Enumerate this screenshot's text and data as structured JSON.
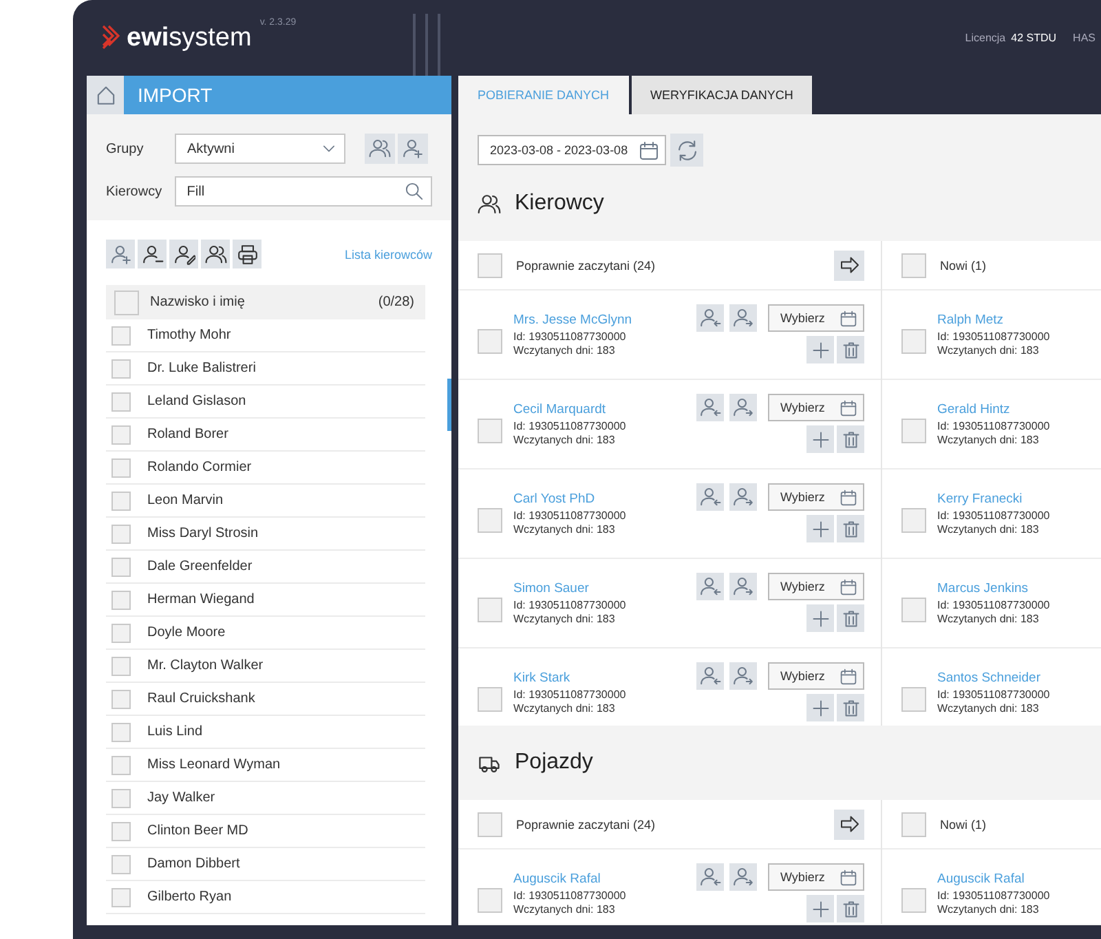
{
  "header": {
    "logo": "**ewi**system",
    "version": "v. 2.3.29",
    "license_label": "Licencja",
    "license_value": "42 STDU",
    "user": "HAS"
  },
  "sidebar": {
    "title": "IMPORT",
    "filters": [
      {
        "kind": "select",
        "label": "Grupy",
        "value": "Aktywni"
      },
      {
        "kind": "search",
        "label": "Kierowcy",
        "value": "Fill"
      }
    ],
    "link": "Lista kierowców",
    "list": {
      "header": "Nazwisko i imię",
      "count": "(0/28)",
      "checked": false,
      "items": [
        {
          "name": "Timothy Mohr",
          "checked": false
        },
        {
          "name": "Dr. Luke Balistreri",
          "checked": false
        },
        {
          "name": "Leland Gislason",
          "checked": false
        },
        {
          "name": "Roland Borer",
          "checked": false
        },
        {
          "name": "Rolando Cormier",
          "checked": false
        },
        {
          "name": "Leon Marvin",
          "checked": false
        },
        {
          "name": "Miss Daryl Strosin",
          "checked": false
        },
        {
          "name": "Dale Greenfelder",
          "checked": false
        },
        {
          "name": "Herman Wiegand",
          "checked": false
        },
        {
          "name": "Doyle Moore",
          "checked": false
        },
        {
          "name": "Mr. Clayton Walker",
          "checked": false
        },
        {
          "name": "Raul Cruickshank",
          "checked": false
        },
        {
          "name": "Luis Lind",
          "checked": false
        },
        {
          "name": "Miss Leonard Wyman",
          "checked": false
        },
        {
          "name": "Jay Walker",
          "checked": false
        },
        {
          "name": "Clinton Beer MD",
          "checked": false
        },
        {
          "name": "Damon Dibbert",
          "checked": false
        },
        {
          "name": "Gilberto Ryan",
          "checked": false
        }
      ]
    }
  },
  "main": {
    "tabs": [
      {
        "label": "POBIERANIE DANYCH",
        "selected": true
      },
      {
        "label": "WERYFIKACJA DANYCH",
        "selected": false
      }
    ],
    "date_range": "2023-03-08 - 2023-03-08",
    "sections": [
      {
        "kind": "drivers",
        "title": "Kierowcy",
        "left": {
          "header": "Poprawnie zaczytani (24)",
          "checked": false,
          "rows": [
            {
              "name": "Mrs. Jesse McGlynn",
              "id": "Id:  1930511087730000",
              "days": "Wczytanych dni:  183",
              "button": "Wybierz",
              "checked": false
            },
            {
              "name": "Cecil Marquardt",
              "id": "Id:  1930511087730000",
              "days": "Wczytanych dni:  183",
              "button": "Wybierz",
              "checked": false
            },
            {
              "name": "Carl Yost PhD",
              "id": "Id:  1930511087730000",
              "days": "Wczytanych dni:  183",
              "button": "Wybierz",
              "checked": false
            },
            {
              "name": "Simon Sauer",
              "id": "Id:  1930511087730000",
              "days": "Wczytanych dni:  183",
              "button": "Wybierz",
              "checked": false
            },
            {
              "name": "Kirk Stark",
              "id": "Id:  1930511087730000",
              "days": "Wczytanych dni:  183",
              "button": "Wybierz",
              "checked": false
            }
          ]
        },
        "right": {
          "header": "Nowi (1)",
          "checked": false,
          "rows": [
            {
              "name": "Ralph Metz",
              "id": "Id:  1930511087730000",
              "days": "Wczytanych dni:  183",
              "checked": false
            },
            {
              "name": "Gerald Hintz",
              "id": "Id:  1930511087730000",
              "days": "Wczytanych dni:  183",
              "checked": false
            },
            {
              "name": "Kerry Franecki",
              "id": "Id:  1930511087730000",
              "days": "Wczytanych dni:  183",
              "checked": false
            },
            {
              "name": "Marcus Jenkins",
              "id": "Id:  1930511087730000",
              "days": "Wczytanych dni:  183",
              "checked": false
            },
            {
              "name": "Santos Schneider",
              "id": "Id:  1930511087730000",
              "days": "Wczytanych dni:  183",
              "checked": false
            }
          ]
        }
      },
      {
        "kind": "vehicles",
        "title": "Pojazdy",
        "left": {
          "header": "Poprawnie zaczytani (24)",
          "checked": false,
          "rows": [
            {
              "name": "Auguscik Rafal",
              "id": "Id:  1930511087730000",
              "days": "Wczytanych dni:  183",
              "button": "Wybierz",
              "checked": false
            }
          ]
        },
        "right": {
          "header": "Nowi (1)",
          "checked": false,
          "rows": [
            {
              "name": "Auguscik Rafal",
              "id": "Id:  1930511087730000",
              "days": "Wczytanych dni:  183",
              "checked": false
            }
          ]
        }
      }
    ]
  }
}
